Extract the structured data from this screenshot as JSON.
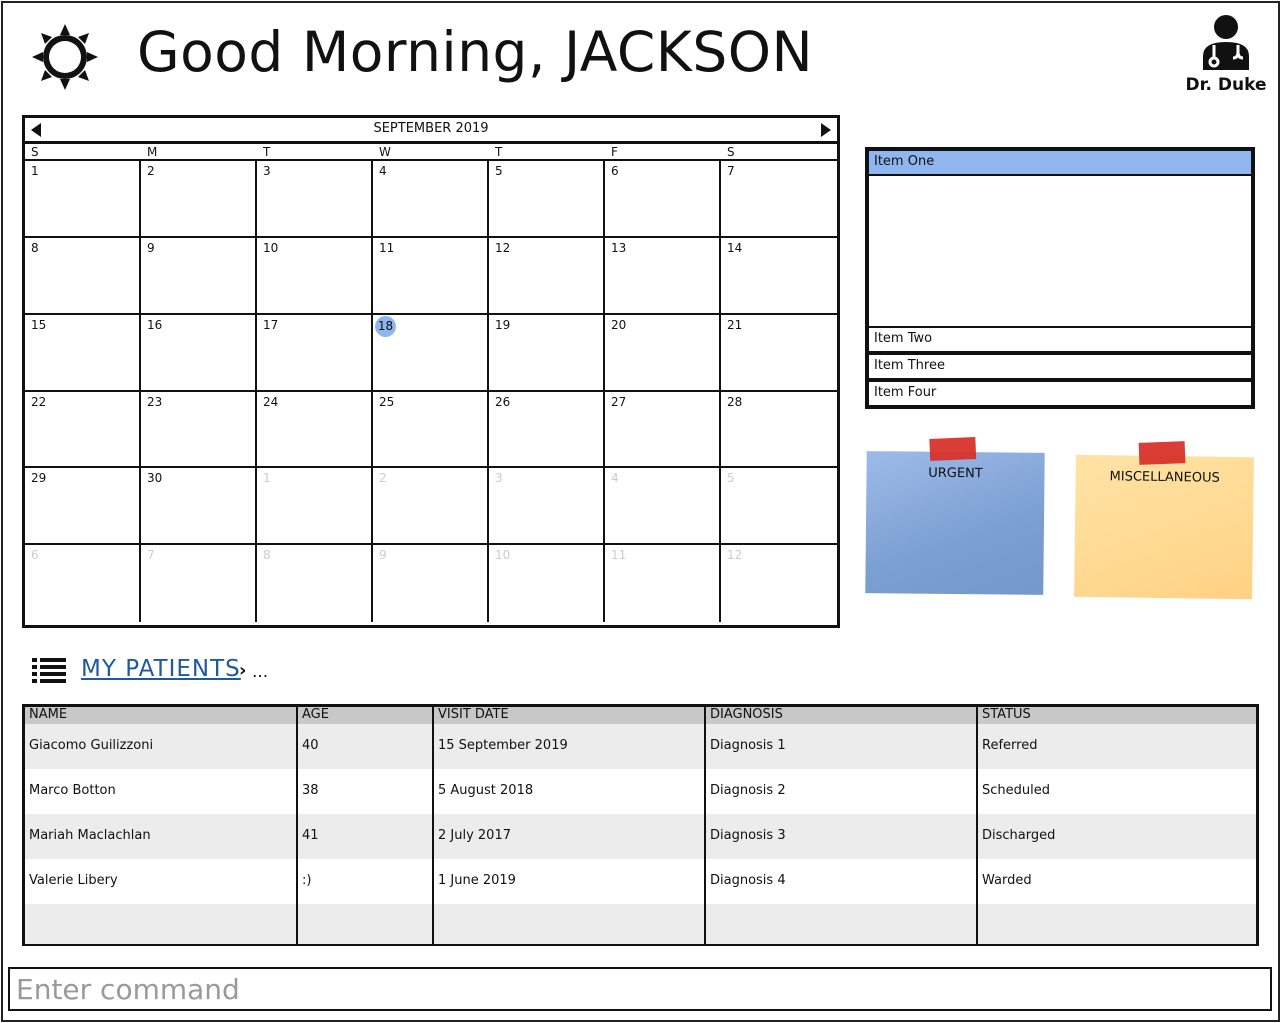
{
  "header": {
    "greeting": "Good Morning, JACKSON",
    "doctor_name": "Dr. Duke"
  },
  "calendar": {
    "month_label": "SEPTEMBER 2019",
    "days_of_week": [
      "S",
      "M",
      "T",
      "W",
      "T",
      "F",
      "S"
    ],
    "selected_day": "18",
    "cells": [
      {
        "d": "1",
        "m": false
      },
      {
        "d": "2",
        "m": false
      },
      {
        "d": "3",
        "m": false
      },
      {
        "d": "4",
        "m": false
      },
      {
        "d": "5",
        "m": false
      },
      {
        "d": "6",
        "m": false
      },
      {
        "d": "7",
        "m": false
      },
      {
        "d": "8",
        "m": false
      },
      {
        "d": "9",
        "m": false
      },
      {
        "d": "10",
        "m": false
      },
      {
        "d": "11",
        "m": false
      },
      {
        "d": "12",
        "m": false
      },
      {
        "d": "13",
        "m": false
      },
      {
        "d": "14",
        "m": false
      },
      {
        "d": "15",
        "m": false
      },
      {
        "d": "16",
        "m": false
      },
      {
        "d": "17",
        "m": false
      },
      {
        "d": "18",
        "m": false
      },
      {
        "d": "19",
        "m": false
      },
      {
        "d": "20",
        "m": false
      },
      {
        "d": "21",
        "m": false
      },
      {
        "d": "22",
        "m": false
      },
      {
        "d": "23",
        "m": false
      },
      {
        "d": "24",
        "m": false
      },
      {
        "d": "25",
        "m": false
      },
      {
        "d": "26",
        "m": false
      },
      {
        "d": "27",
        "m": false
      },
      {
        "d": "28",
        "m": false
      },
      {
        "d": "29",
        "m": false
      },
      {
        "d": "30",
        "m": false
      },
      {
        "d": "1",
        "m": true
      },
      {
        "d": "2",
        "m": true
      },
      {
        "d": "3",
        "m": true
      },
      {
        "d": "4",
        "m": true
      },
      {
        "d": "5",
        "m": true
      },
      {
        "d": "6",
        "m": true
      },
      {
        "d": "7",
        "m": true
      },
      {
        "d": "8",
        "m": true
      },
      {
        "d": "9",
        "m": true
      },
      {
        "d": "10",
        "m": true
      },
      {
        "d": "11",
        "m": true
      },
      {
        "d": "12",
        "m": true
      }
    ]
  },
  "accordion": {
    "items": [
      "Item One",
      "Item Two",
      "Item Three",
      "Item Four"
    ],
    "selected_index": 0
  },
  "notes": {
    "urgent": "URGENT",
    "misc": "MISCELLANEOUS"
  },
  "patients": {
    "link_label": "MY PATIENTS",
    "crumb_separator": "›",
    "crumb_more": "...",
    "columns": [
      "NAME",
      "AGE",
      "VISIT DATE",
      "DIAGNOSIS",
      "STATUS"
    ],
    "rows": [
      [
        "Giacomo Guilizzoni",
        "40",
        "15 September 2019",
        "Diagnosis 1",
        "Referred"
      ],
      [
        "Marco Botton",
        "38",
        "5 August 2018",
        "Diagnosis 2",
        "Scheduled"
      ],
      [
        "Mariah Maclachlan",
        "41",
        "2 July 2017",
        "Diagnosis 3",
        "Discharged"
      ],
      [
        "Valerie Libery",
        ":)",
        "1 June 2019",
        "Diagnosis 4",
        "Warded"
      ]
    ]
  },
  "command": {
    "placeholder": "Enter command",
    "value": ""
  },
  "icons": {
    "sun": "sun-icon",
    "doctor": "doctor-avatar-icon",
    "list": "list-icon",
    "prev": "chevron-left-icon",
    "next": "chevron-right-icon"
  },
  "colors": {
    "selection_blue": "#8fb6ee",
    "link_blue": "#1d5aa1",
    "note_blue": "#7b9fd1",
    "note_yellow": "#ffd991",
    "tape_red": "#d8322b",
    "table_header": "#c8c8c8"
  }
}
